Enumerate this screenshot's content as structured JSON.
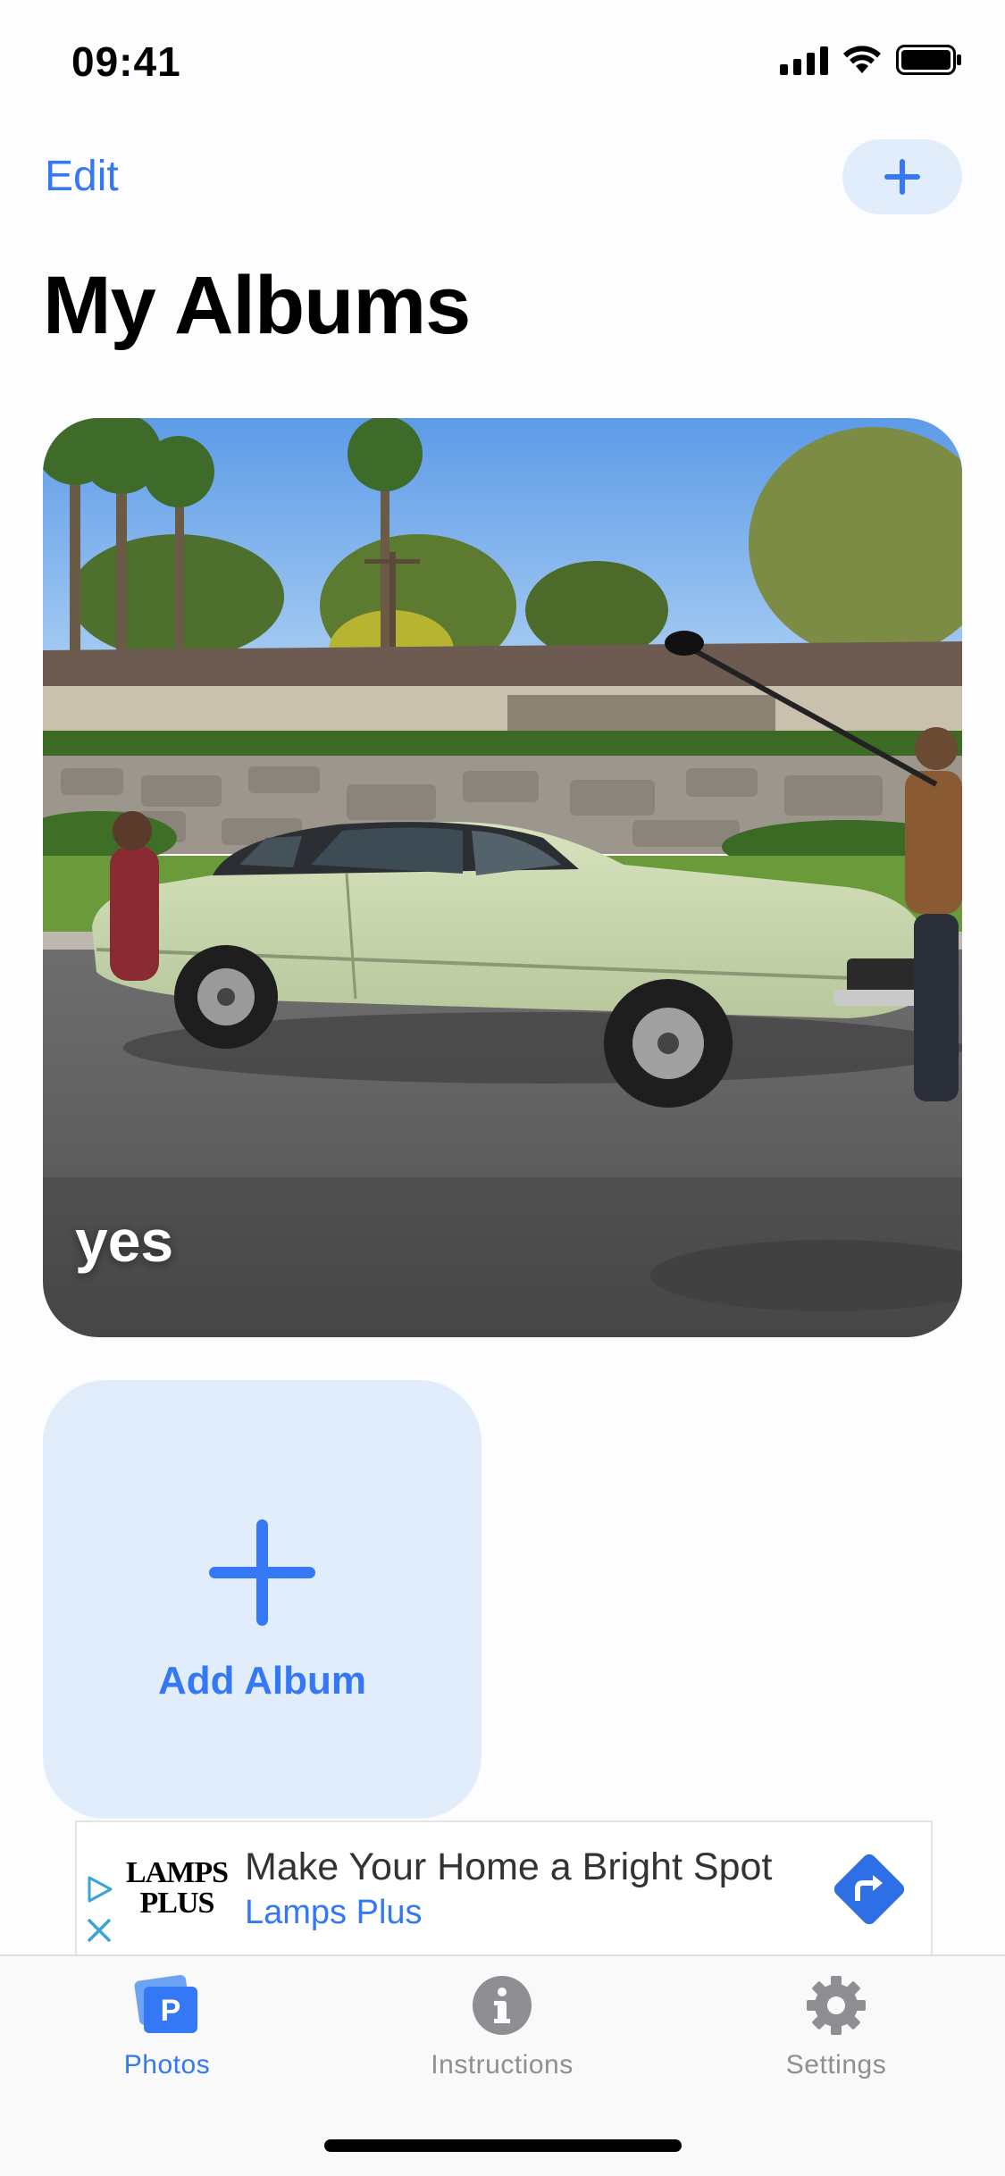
{
  "status_bar": {
    "time": "09:41"
  },
  "nav": {
    "edit_label": "Edit",
    "add_icon": "plus-icon"
  },
  "page_title": "My Albums",
  "albums": [
    {
      "name": "yes"
    }
  ],
  "add_album": {
    "label": "Add Album"
  },
  "ad": {
    "logo_line1": "LAMPS",
    "logo_line2": "PLUS",
    "headline": "Make Your Home a Bright Spot",
    "advertiser": "Lamps Plus"
  },
  "tabs": [
    {
      "label": "Photos",
      "icon": "photos-icon",
      "active": true
    },
    {
      "label": "Instructions",
      "icon": "info-icon",
      "active": false
    },
    {
      "label": "Settings",
      "icon": "gear-icon",
      "active": false
    }
  ],
  "colors": {
    "accent": "#3478f6",
    "tile_bg": "#e2edfc",
    "inactive": "#8e8e93"
  }
}
